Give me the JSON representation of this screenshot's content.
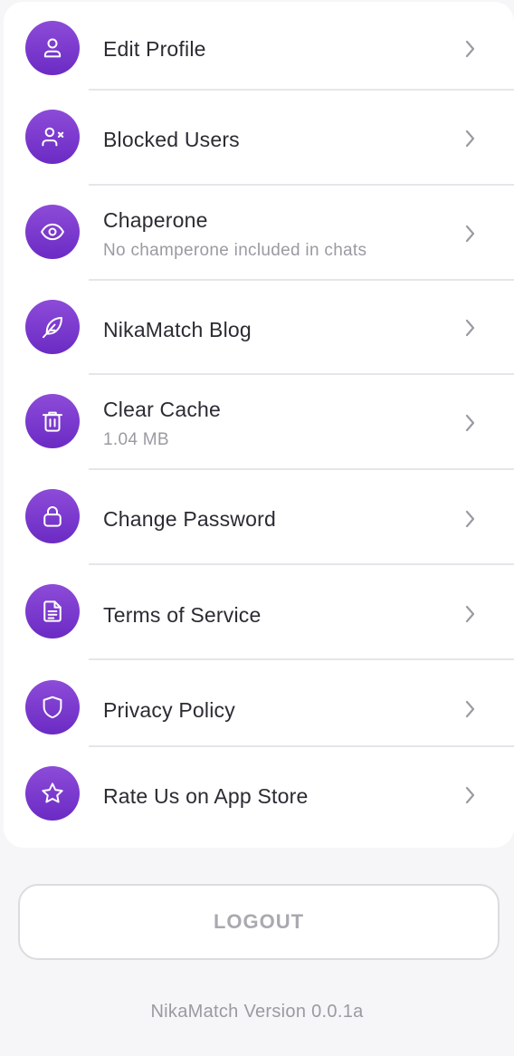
{
  "menu": {
    "items": [
      {
        "label": "Edit Profile",
        "icon": "user-icon"
      },
      {
        "label": "Blocked Users",
        "icon": "user-x-icon"
      },
      {
        "label": "Chaperone",
        "subtitle": "No champerone included in chats",
        "icon": "eye-icon"
      },
      {
        "label": "NikaMatch Blog",
        "icon": "feather-icon"
      },
      {
        "label": "Clear Cache",
        "subtitle": "1.04 MB",
        "icon": "trash-icon"
      },
      {
        "label": "Change Password",
        "icon": "lock-icon"
      },
      {
        "label": "Terms of Service",
        "icon": "document-icon"
      },
      {
        "label": "Privacy Policy",
        "icon": "shield-icon"
      },
      {
        "label": "Rate Us on App Store",
        "icon": "star-icon"
      }
    ]
  },
  "logout_label": "LOGOUT",
  "version_text": "NikaMatch Version 0.0.1a",
  "colors": {
    "accent": "#7b3bd0",
    "background": "#f6f6f8",
    "text": "#2b2b33",
    "muted": "#9a9aa2"
  }
}
